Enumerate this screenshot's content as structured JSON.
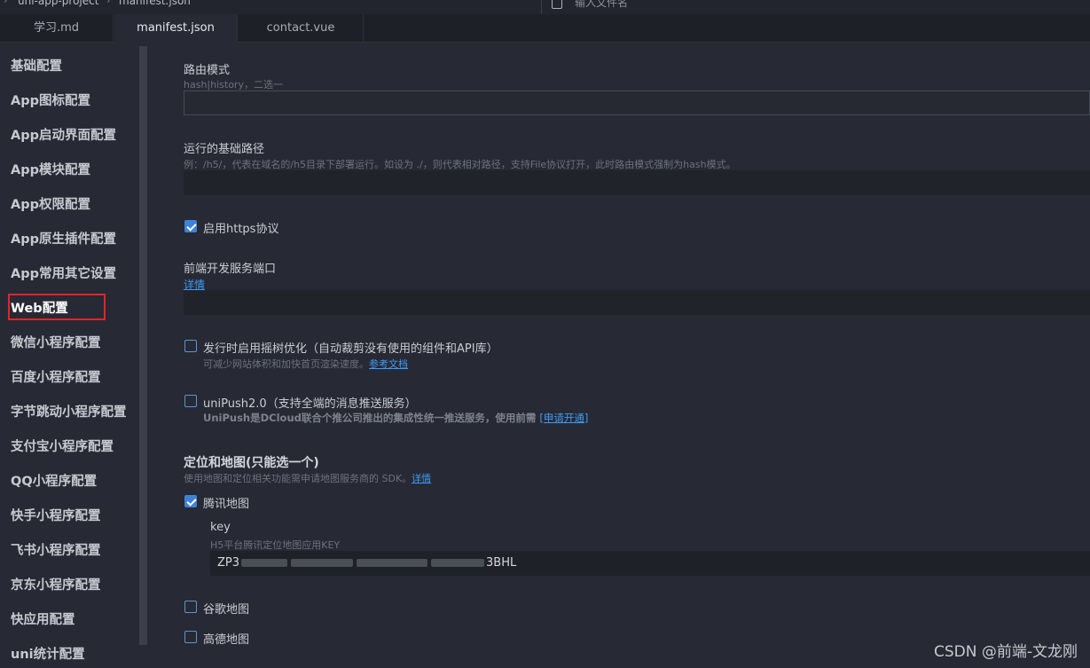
{
  "topbar": {
    "breadcrumb": [
      "uni-app-project",
      "manifest.json"
    ],
    "search_placeholder": "输入文件名"
  },
  "tabs": [
    {
      "label": "学习.md",
      "active": false
    },
    {
      "label": "manifest.json",
      "active": true
    },
    {
      "label": "contact.vue",
      "active": false
    }
  ],
  "sidebar": {
    "items": [
      {
        "label": "基础配置"
      },
      {
        "label": "App图标配置"
      },
      {
        "label": "App启动界面配置"
      },
      {
        "label": "App模块配置"
      },
      {
        "label": "App权限配置"
      },
      {
        "label": "App原生插件配置"
      },
      {
        "label": "App常用其它设置"
      },
      {
        "label": "Web配置",
        "active": true
      },
      {
        "label": "微信小程序配置"
      },
      {
        "label": "百度小程序配置"
      },
      {
        "label": "字节跳动小程序配置"
      },
      {
        "label": "支付宝小程序配置"
      },
      {
        "label": "QQ小程序配置"
      },
      {
        "label": "快手小程序配置"
      },
      {
        "label": "飞书小程序配置"
      },
      {
        "label": "京东小程序配置"
      },
      {
        "label": "快应用配置"
      },
      {
        "label": "uni统计配置"
      }
    ]
  },
  "main": {
    "router_mode": {
      "label": "路由模式",
      "hint": "hash|history，二选一",
      "value": ""
    },
    "base_path": {
      "label": "运行的基础路径",
      "hint": "例：/h5/，代表在域名的/h5目录下部署运行。如设为 ./，则代表相对路径，支持File协议打开，此时路由模式强制为hash模式。",
      "value": ""
    },
    "https": {
      "label": "启用https协议",
      "checked": true
    },
    "dev_port": {
      "label": "前端开发服务端口",
      "link": "详情",
      "value": ""
    },
    "tree_shaking": {
      "label": "发行时启用摇树优化（自动裁剪没有使用的组件和API库）",
      "hint": "可减少网站体积和加快首页渲染速度。",
      "link": "参考文档",
      "checked": false
    },
    "unipush": {
      "label": "uniPush2.0（支持全端的消息推送服务）",
      "hint": "UniPush是DCloud联合个推公司推出的集成性统一推送服务，使用前需",
      "link": "[申请开通]",
      "checked": false
    },
    "map_section": {
      "title": "定位和地图(只能选一个)",
      "hint": "使用地图和定位相关功能需申请地图服务商的 SDK。",
      "link": "详情",
      "tencent": {
        "label": "腾讯地图",
        "checked": true
      },
      "key": {
        "label": "key",
        "hint": "H5平台腾讯定位地图应用KEY",
        "prefix": "ZP3",
        "suffix": "3BHL"
      },
      "google": {
        "label": "谷歌地图",
        "checked": false
      },
      "amap": {
        "label": "高德地图",
        "checked": false
      }
    }
  },
  "watermark": "CSDN @前端-文龙刚",
  "colors": {
    "accent": "#3e82d8",
    "highlight_border": "#e0252a",
    "link": "#3d9af5"
  }
}
